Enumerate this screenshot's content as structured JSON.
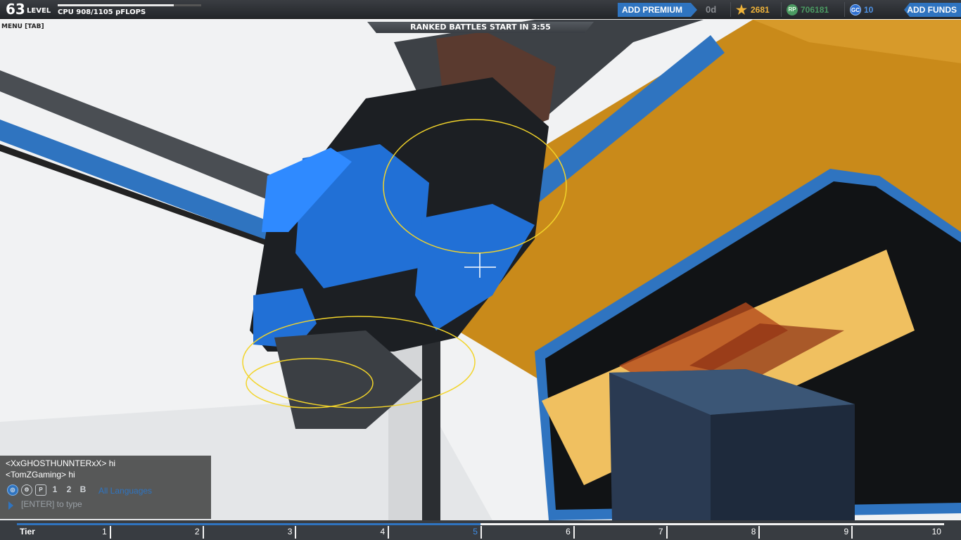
{
  "hud": {
    "level": "63",
    "level_label": "LEVEL",
    "xp_progress": 0.81,
    "cpu": "CPU 908/1105 pFLOPS",
    "menu_hint": "MENU [TAB]",
    "ranked_banner": "RANKED BATTLES START IN 3:55"
  },
  "currency": {
    "add_premium_label": "ADD PREMIUM",
    "premium_days": "0d",
    "stars": "2681",
    "rp_icon": "RP",
    "robits": "706181",
    "gc_icon": "GC",
    "galaxy_coins": "10",
    "add_funds_label": "ADD FUNDS"
  },
  "chat": {
    "messages": [
      {
        "text": "<XxGHOSTHUNNTERxX> hi"
      },
      {
        "text": "<TomZGaming> hi"
      }
    ],
    "channels": [
      {
        "name": "globe-icon",
        "glyph": "◎"
      },
      {
        "name": "faction-icon",
        "glyph": "⚙"
      },
      {
        "name": "party-icon",
        "glyph": "P"
      },
      {
        "name": "team-1-icon",
        "glyph": "1"
      },
      {
        "name": "team-2-icon",
        "glyph": "2"
      },
      {
        "name": "team-3-icon",
        "glyph": "B"
      }
    ],
    "language": "All Languages",
    "input_placeholder": "[ENTER] to type"
  },
  "tiers": {
    "label": "Tier",
    "values": [
      "1",
      "2",
      "3",
      "4",
      "5",
      "6",
      "7",
      "8",
      "9",
      "10"
    ],
    "current": "5"
  },
  "colors": {
    "accent": "#2f74c0",
    "star": "#f0b43a",
    "rp": "#4b9a62"
  }
}
